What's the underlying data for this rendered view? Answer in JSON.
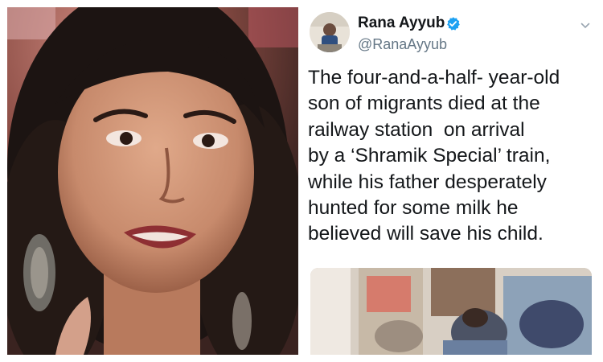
{
  "tweet": {
    "display_name": "Rana Ayyub",
    "handle": "@RanaAyyub",
    "verified": true,
    "lines": [
      "The four-and-a-half- year-old",
      "son of migrants died at the",
      "railway station  on arrival",
      "by a ‘Shramik Special’ train,",
      "while his father desperately",
      "hunted for some milk he",
      "believed will save his child."
    ]
  },
  "icons": {
    "verified": "verified-badge-icon",
    "menu": "chevron-down-icon"
  },
  "colors": {
    "verified_blue": "#1da1f2",
    "text": "#14171a",
    "handle_gray": "#657786"
  }
}
